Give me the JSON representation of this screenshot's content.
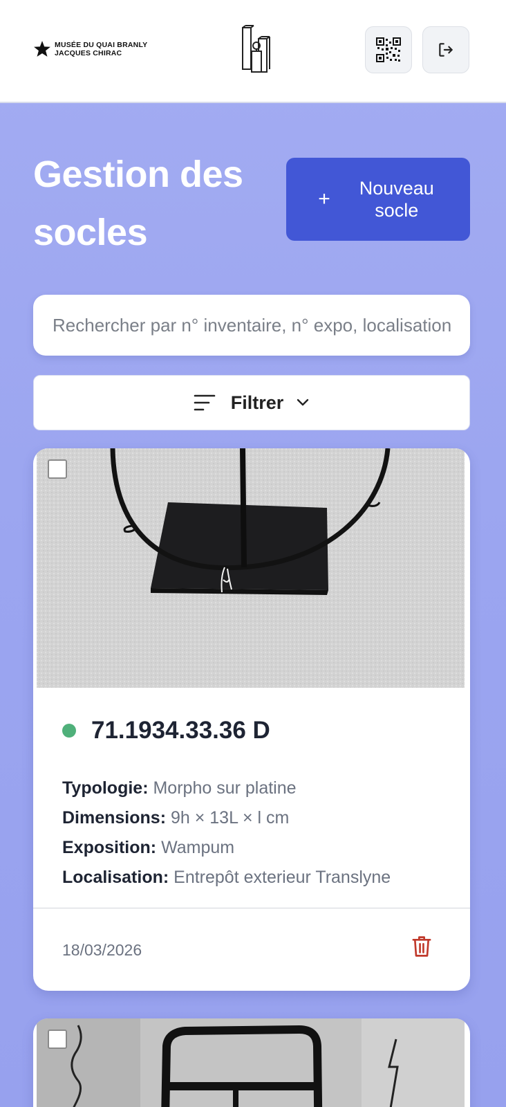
{
  "header": {
    "logo_line1": "MUSÉE DU QUAI BRANLY",
    "logo_line2": "JACQUES CHIRAC",
    "qr_icon": "qr-code-icon",
    "logout_icon": "logout-icon"
  },
  "main": {
    "title": "Gestion des socles",
    "new_button_label": "Nouveau socle",
    "search_placeholder": "Rechercher par n° inventaire, n° expo, localisation",
    "filter_label": "Filtrer"
  },
  "cards": [
    {
      "reference": "71.1934.33.36 D",
      "status_color": "#4fb07a",
      "typologie_label": "Typologie:",
      "typologie": "Morpho sur platine",
      "dimensions_label": "Dimensions:",
      "dimensions": "9h × 13L × l cm",
      "exposition_label": "Exposition:",
      "exposition": "Wampum",
      "localisation_label": "Localisation:",
      "localisation": "Entrepôt exterieur Translyne",
      "date": "18/03/2026",
      "delete_icon": "trash-icon"
    }
  ],
  "colors": {
    "accent": "#4257d6",
    "background": "#9ba5f0",
    "danger": "#c0392b"
  }
}
